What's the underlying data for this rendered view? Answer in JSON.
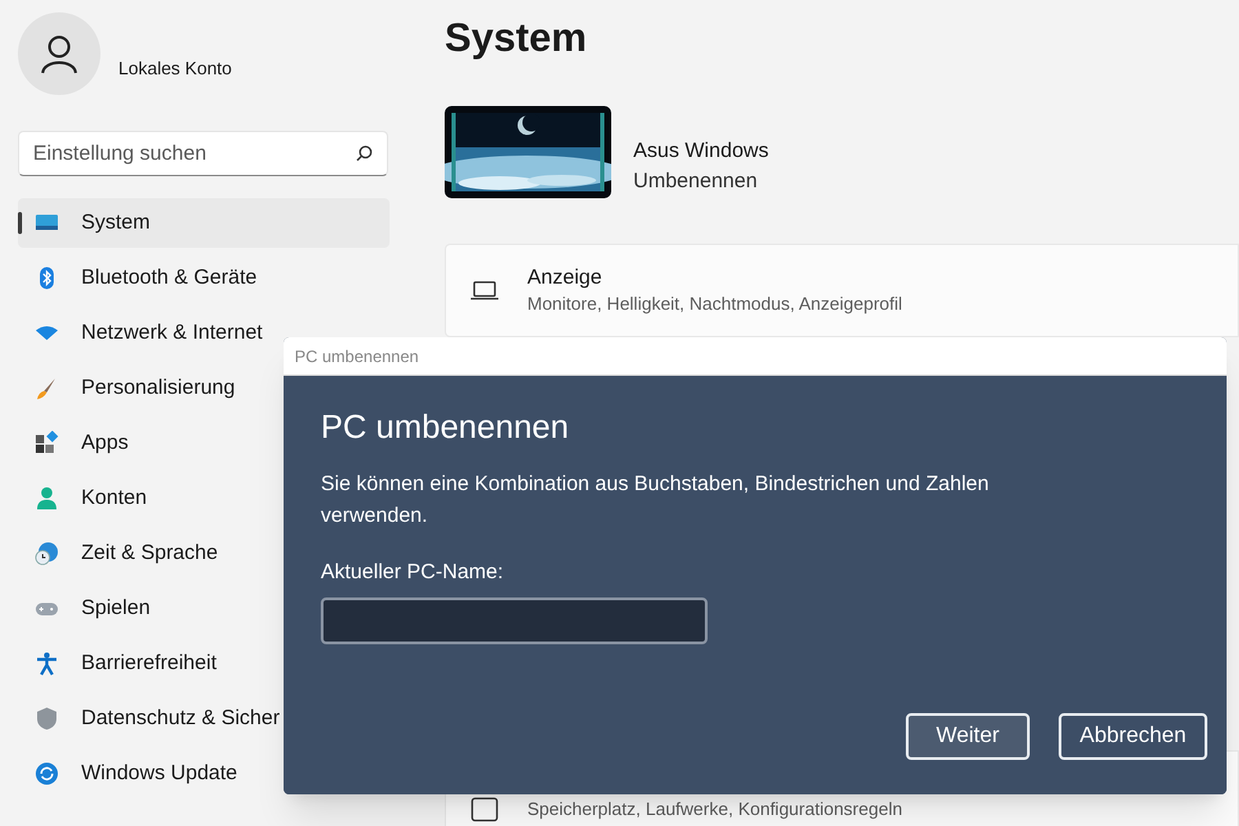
{
  "account": {
    "name": "Lokales Konto"
  },
  "search": {
    "placeholder": "Einstellung suchen"
  },
  "sidebar": {
    "items": [
      {
        "label": "System",
        "selected": true
      },
      {
        "label": "Bluetooth & Geräte",
        "selected": false
      },
      {
        "label": "Netzwerk & Internet",
        "selected": false
      },
      {
        "label": "Personalisierung",
        "selected": false
      },
      {
        "label": "Apps",
        "selected": false
      },
      {
        "label": "Konten",
        "selected": false
      },
      {
        "label": "Zeit & Sprache",
        "selected": false
      },
      {
        "label": "Spielen",
        "selected": false
      },
      {
        "label": "Barrierefreiheit",
        "selected": false
      },
      {
        "label": "Datenschutz & Sicher",
        "selected": false
      },
      {
        "label": "Windows Update",
        "selected": false
      }
    ]
  },
  "page": {
    "title": "System",
    "device_name": "Asus Windows",
    "rename_link": "Umbenennen"
  },
  "cards": [
    {
      "title": "Anzeige",
      "subtitle": "Monitore, Helligkeit, Nachtmodus, Anzeigeprofil"
    },
    {
      "subtitle": "Speicherplatz, Laufwerke, Konfigurationsregeln"
    }
  ],
  "dialog": {
    "window_title": "PC umbenennen",
    "heading": "PC umbenennen",
    "message": "Sie können eine Kombination aus Buchstaben, Bindestrichen und Zahlen verwenden.",
    "field_label": "Aktueller PC-Name:",
    "buttons": [
      "Weiter",
      "Abbrechen"
    ]
  }
}
